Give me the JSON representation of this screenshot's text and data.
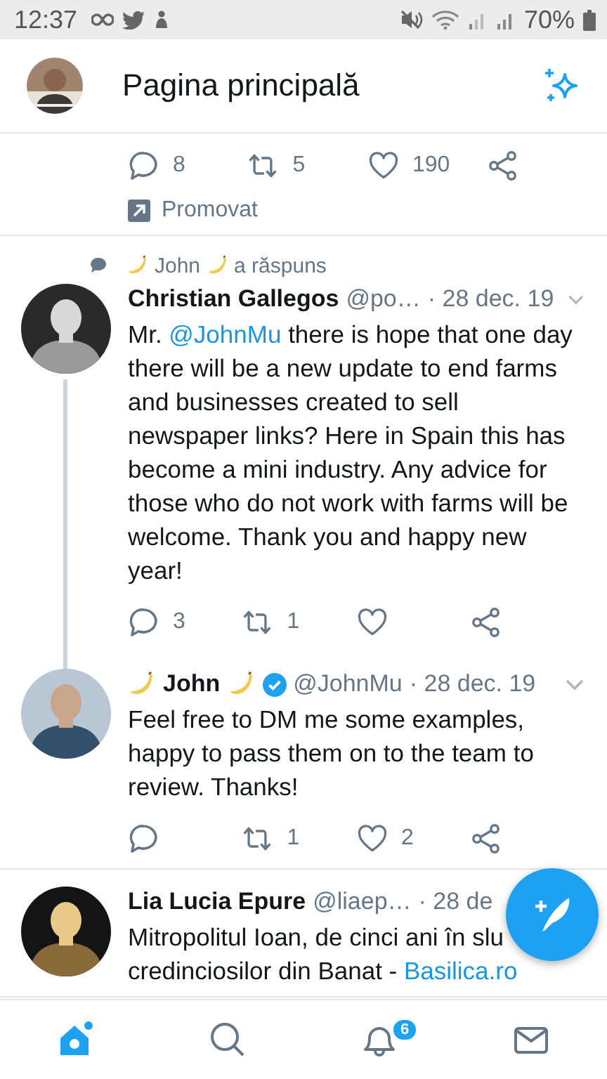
{
  "status_bar": {
    "time": "12:37",
    "battery": "70%"
  },
  "header": {
    "title": "Pagina principală"
  },
  "promoted_tweet": {
    "actions": {
      "reply": "8",
      "retweet": "5",
      "like": "190"
    },
    "promoted_label": "Promovat"
  },
  "tweets": [
    {
      "reply_context": {
        "name": "John",
        "text": "a răspuns",
        "decorated": true
      },
      "name": "Christian Gallegos",
      "handle": "@po…",
      "date": "· 28 dec. 19",
      "decorated": false,
      "verified": false,
      "menu": true,
      "thread_continues": true,
      "body": [
        {
          "kind": "plain",
          "text": "Mr. "
        },
        {
          "kind": "mention",
          "text": "@JohnMu"
        },
        {
          "kind": "plain",
          "text": " there is hope that one day there will be a new update to end farms and businesses created to sell newspaper links? Here in Spain this has become a mini industry. Any advice for those who do not work with farms will be welcome. Thank you and happy new year!"
        }
      ],
      "actions": {
        "reply": "3",
        "retweet": "1"
      }
    },
    {
      "name": "John",
      "handle": "@JohnMu",
      "date": "· 28 dec. 19",
      "decorated": true,
      "verified": true,
      "menu": true,
      "thread_continues": false,
      "body": [
        {
          "kind": "plain",
          "text": "Feel free to DM me some examples, happy to pass them on to the team to review. Thanks!"
        }
      ],
      "actions": {
        "retweet": "1",
        "like": "2"
      }
    },
    {
      "name": "Lia Lucia Epure",
      "handle": "@liaep…",
      "date": "· 28 de",
      "decorated": false,
      "verified": false,
      "thread_continues": false,
      "body": [
        {
          "kind": "plain",
          "text": "Mitropolitul Ioan, de cinci ani în slu\ncredinciosilor din Banat - "
        },
        {
          "kind": "mention",
          "text": "Basilica.ro"
        }
      ]
    }
  ],
  "bottom_nav": [
    {
      "kind": "home",
      "selected": true
    },
    {
      "kind": "search",
      "selected": false
    },
    {
      "kind": "notifications",
      "selected": false,
      "badge": "6"
    },
    {
      "kind": "messages",
      "selected": false
    }
  ]
}
